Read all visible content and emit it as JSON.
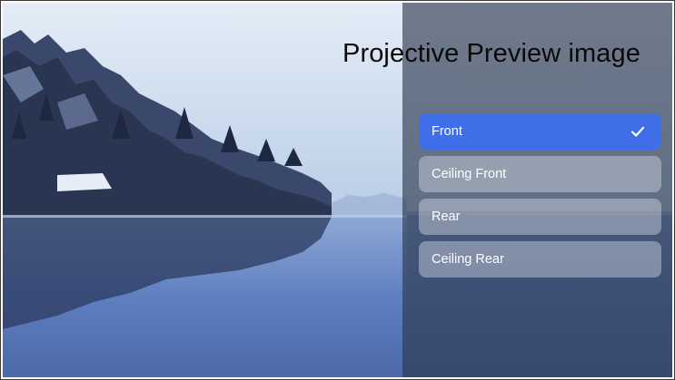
{
  "screen": {
    "title": "Projective Preview image"
  },
  "options": [
    {
      "label": "Front",
      "selected": true
    },
    {
      "label": "Ceiling Front",
      "selected": false
    },
    {
      "label": "Rear",
      "selected": false
    },
    {
      "label": "Ceiling Rear",
      "selected": false
    }
  ],
  "icons": {
    "selected_indicator": "check-icon"
  },
  "colors": {
    "selected_bg": "#3f6ee8",
    "option_text": "#ffffff",
    "title_text": "#0a0a0a"
  }
}
